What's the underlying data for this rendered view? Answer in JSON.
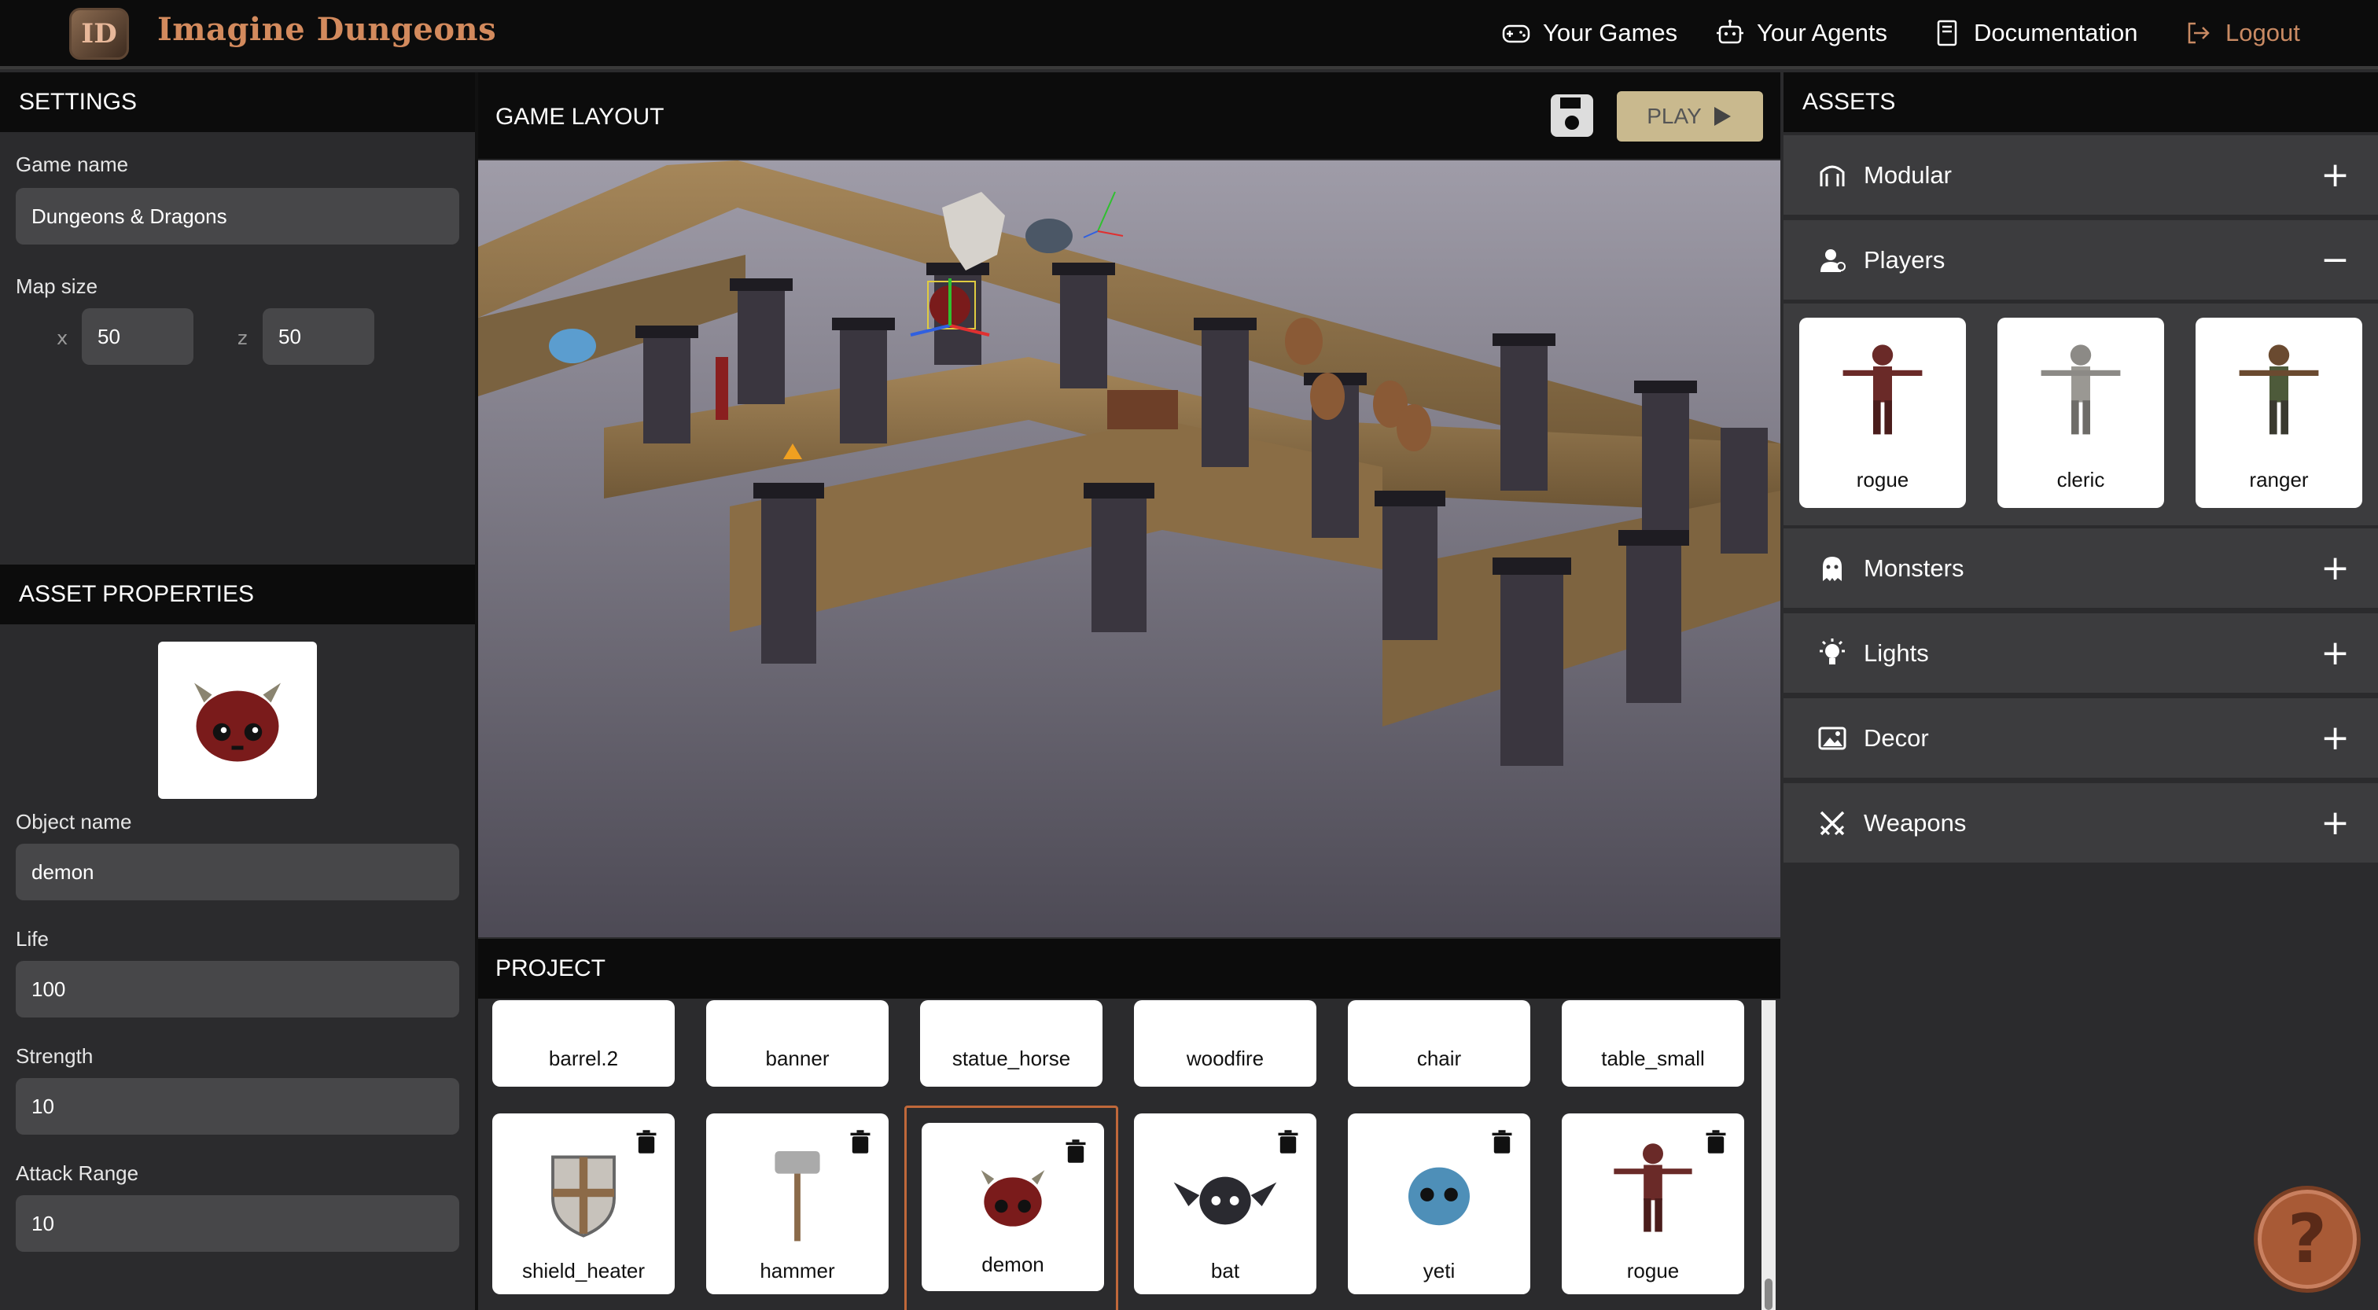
{
  "app": {
    "logo_text": "Imagine Dungeons",
    "logo_badge": "ID",
    "nav": [
      {
        "label": "Your Games",
        "icon": "gamepad-icon"
      },
      {
        "label": "Your Agents",
        "icon": "robot-icon"
      },
      {
        "label": "Documentation",
        "icon": "book-icon"
      },
      {
        "label": "Logout",
        "icon": "logout-icon"
      }
    ]
  },
  "settings": {
    "title": "SETTINGS",
    "game_name_label": "Game name",
    "game_name": "Dungeons & Dragons",
    "map_size_label": "Map size",
    "x_label": "x",
    "x_value": "50",
    "z_label": "z",
    "z_value": "50"
  },
  "asset_properties": {
    "title": "ASSET PROPERTIES",
    "object_name_label": "Object name",
    "object_name": "demon",
    "life_label": "Life",
    "life": "100",
    "strength_label": "Strength",
    "strength": "10",
    "attack_range_label": "Attack Range",
    "attack_range": "10"
  },
  "game_layout": {
    "title": "GAME LAYOUT",
    "play_label": "PLAY"
  },
  "project": {
    "title": "PROJECT",
    "row1": [
      "barrel.2",
      "banner",
      "statue_horse",
      "woodfire",
      "chair",
      "table_small"
    ],
    "row2": [
      "shield_heater",
      "hammer",
      "demon",
      "bat",
      "yeti",
      "rogue"
    ],
    "selected": "demon"
  },
  "assets": {
    "title": "ASSETS",
    "categories": [
      {
        "label": "Modular",
        "expanded": false
      },
      {
        "label": "Players",
        "expanded": true
      },
      {
        "label": "Monsters",
        "expanded": false
      },
      {
        "label": "Lights",
        "expanded": false
      },
      {
        "label": "Decor",
        "expanded": false
      },
      {
        "label": "Weapons",
        "expanded": false
      }
    ],
    "players": [
      "rogue",
      "cleric",
      "ranger"
    ],
    "expand_sign": "+",
    "collapse_sign": "−"
  },
  "help_label": "?",
  "colors": {
    "accent": "#c98a63",
    "play_button": "#c9b98e",
    "selected_border": "#c0683a"
  }
}
